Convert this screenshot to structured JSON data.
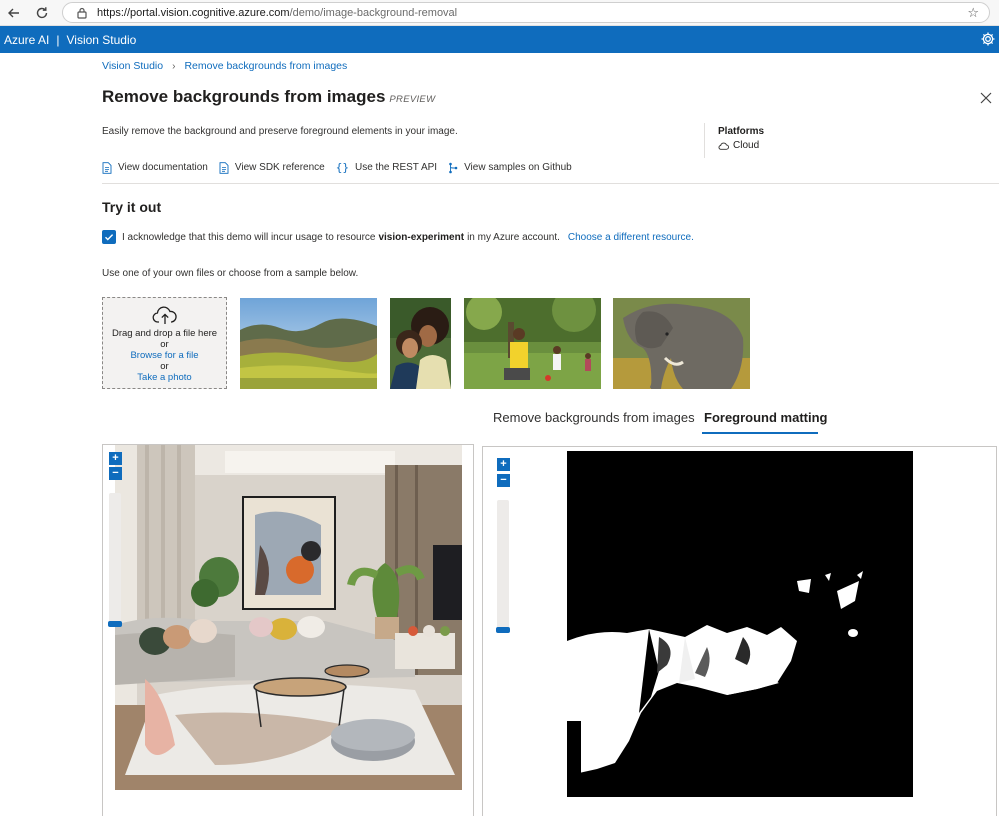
{
  "browser": {
    "url_host": "https://portal.vision.cognitive.azure.com",
    "url_path": "/demo/image-background-removal"
  },
  "appbar": {
    "product": "Azure AI",
    "separator": "|",
    "app": "Vision Studio"
  },
  "breadcrumb": {
    "root": "Vision Studio",
    "current": "Remove backgrounds from images"
  },
  "page": {
    "title": "Remove backgrounds from images",
    "badge": "PREVIEW",
    "description": "Easily remove the background and preserve foreground elements in your image.",
    "platforms_label": "Platforms",
    "platforms_value": "Cloud"
  },
  "links": [
    {
      "label": "View documentation",
      "icon": "document-icon"
    },
    {
      "label": "View SDK reference",
      "icon": "document-icon"
    },
    {
      "label": "Use the REST API",
      "icon": "braces-icon"
    },
    {
      "label": "View samples on Github",
      "icon": "branch-icon"
    }
  ],
  "try_it": {
    "heading": "Try it out",
    "ack_prefix": "I acknowledge that this demo will incur usage to resource",
    "resource": "vision-experiment",
    "ack_suffix": "in my Azure account.",
    "change_link": "Choose a different resource.",
    "hint": "Use one of your own files or choose from a sample below."
  },
  "upload": {
    "drag_text": "Drag and drop a file here",
    "or1": "or",
    "browse": "Browse for a file",
    "or2": "or",
    "photo": "Take a photo"
  },
  "tabs": [
    {
      "label": "Remove backgrounds from images",
      "active": false
    },
    {
      "label": "Foreground matting",
      "active": true
    }
  ],
  "viewer": {
    "zoom_in": "+",
    "zoom_out": "−"
  },
  "colors": {
    "accent": "#0f6cbd"
  }
}
